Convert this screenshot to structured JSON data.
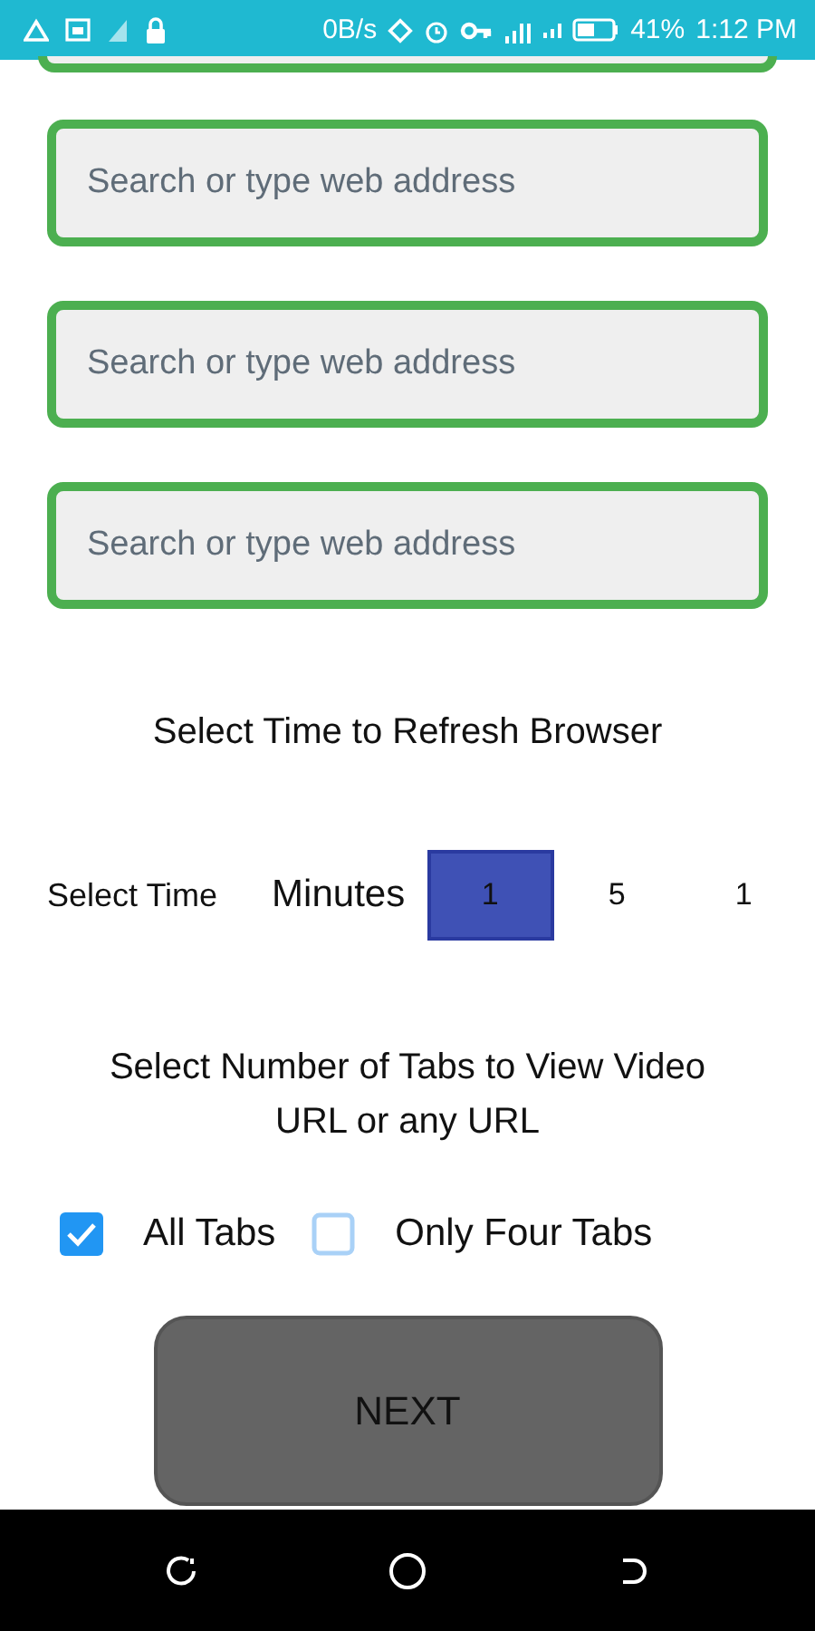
{
  "status_bar": {
    "network_speed": "0B/s",
    "battery": "41%",
    "time": "1:12 PM"
  },
  "fields": [
    {
      "placeholder": "Search or type web address"
    },
    {
      "placeholder": "Search or type web address"
    },
    {
      "placeholder": "Search or type web address"
    }
  ],
  "refresh_heading": "Select Time to Refresh Browser",
  "time_row": {
    "label": "Select Time",
    "unit": "Minutes",
    "options": [
      {
        "label": "1",
        "selected": true
      },
      {
        "label": "5",
        "selected": false
      },
      {
        "label": "1",
        "selected": false
      }
    ]
  },
  "tabs_heading": "Select Number of Tabs to View Video URL or any URL",
  "tab_options": [
    {
      "label": "All Tabs",
      "checked": true
    },
    {
      "label": "Only Four Tabs",
      "checked": false
    }
  ],
  "next_button": "NEXT"
}
